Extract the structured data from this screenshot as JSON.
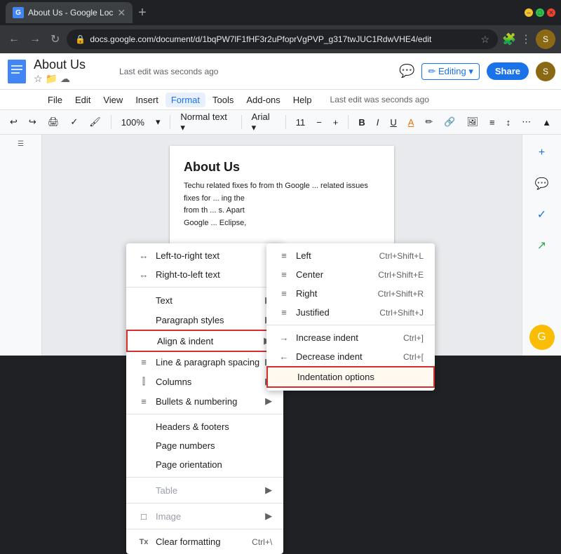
{
  "titlebar": {
    "tab_title": "About Us - Google Loc",
    "tab_favicon": "G",
    "new_tab_label": "+",
    "controls": {
      "minimize": "–",
      "maximize": "□",
      "close": "✕"
    }
  },
  "addressbar": {
    "url": "docs.google.com/document/d/1bqPW7lF1fHF3r2uPfoprVgPVP_g317twJUC1RdwVHE4/edit",
    "back": "←",
    "forward": "→",
    "refresh": "↻"
  },
  "docs_header": {
    "title": "About Us",
    "share_label": "Share",
    "last_edit": "Last edit was seconds ago"
  },
  "menubar": {
    "items": [
      "File",
      "Edit",
      "View",
      "Insert",
      "Format",
      "Tools",
      "Add-ons",
      "Help"
    ]
  },
  "toolbar": {
    "zoom": "100%"
  },
  "format_menu": {
    "items": [
      {
        "id": "left-to-right",
        "icon": "↔",
        "label": "Left-to-right text",
        "has_arrow": false
      },
      {
        "id": "right-to-left",
        "icon": "↔",
        "label": "Right-to-left text",
        "has_arrow": false
      },
      {
        "id": "divider1"
      },
      {
        "id": "text",
        "label": "Text",
        "has_arrow": true
      },
      {
        "id": "paragraph-styles",
        "label": "Paragraph styles",
        "has_arrow": true
      },
      {
        "id": "align-indent",
        "label": "Align & indent",
        "has_arrow": true,
        "highlighted": true
      },
      {
        "id": "line-paragraph-spacing",
        "icon": "≡",
        "label": "Line & paragraph spacing",
        "has_arrow": true
      },
      {
        "id": "columns",
        "icon": "⫿",
        "label": "Columns",
        "has_arrow": true
      },
      {
        "id": "bullets-numbering",
        "icon": "≡",
        "label": "Bullets & numbering",
        "has_arrow": true
      },
      {
        "id": "divider2"
      },
      {
        "id": "headers-footers",
        "label": "Headers & footers",
        "has_arrow": false
      },
      {
        "id": "page-numbers",
        "label": "Page numbers",
        "has_arrow": false
      },
      {
        "id": "page-orientation",
        "label": "Page orientation",
        "has_arrow": false
      },
      {
        "id": "divider3"
      },
      {
        "id": "table",
        "label": "Table",
        "has_arrow": true,
        "disabled": true
      },
      {
        "id": "divider4"
      },
      {
        "id": "image",
        "icon": "□",
        "label": "Image",
        "has_arrow": true,
        "disabled": true
      },
      {
        "id": "divider5"
      },
      {
        "id": "clear-formatting",
        "icon": "T",
        "label": "Clear formatting",
        "shortcut": "Ctrl+\\"
      }
    ]
  },
  "align_submenu": {
    "items": [
      {
        "id": "left",
        "icon": "≡",
        "label": "Left",
        "shortcut": "Ctrl+Shift+L"
      },
      {
        "id": "center",
        "icon": "≡",
        "label": "Center",
        "shortcut": "Ctrl+Shift+E"
      },
      {
        "id": "right",
        "icon": "≡",
        "label": "Right",
        "shortcut": "Ctrl+Shift+R"
      },
      {
        "id": "justified",
        "icon": "≡",
        "label": "Justified",
        "shortcut": "Ctrl+Shift+J"
      },
      {
        "id": "divider1"
      },
      {
        "id": "increase-indent",
        "icon": "→",
        "label": "Increase indent",
        "shortcut": "Ctrl+]"
      },
      {
        "id": "decrease-indent",
        "icon": "←",
        "label": "Decrease indent",
        "shortcut": "Ctrl+["
      },
      {
        "id": "indentation-options",
        "label": "Indentation options",
        "highlighted": true
      }
    ]
  },
  "doc_content": {
    "title": "About Us",
    "text": "Techu related fixes fo from th Google"
  },
  "right_sidebar": {
    "icons": [
      "👤",
      "📄",
      "✓",
      "+",
      "↗"
    ]
  }
}
